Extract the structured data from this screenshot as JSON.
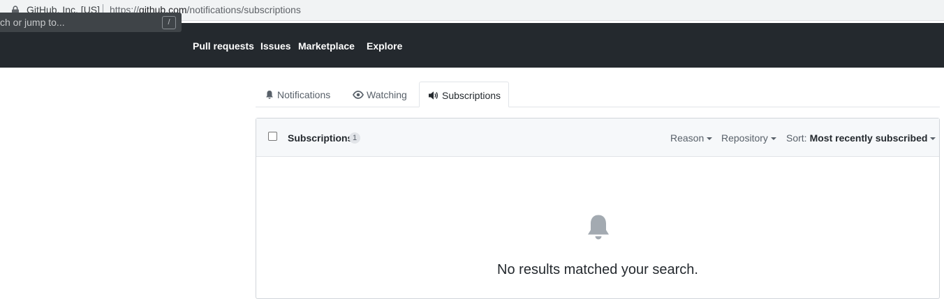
{
  "browser": {
    "site_identity": "GitHub, Inc. [US]",
    "url_scheme": "https://",
    "url_host": "github.com",
    "url_path": "/notifications/subscriptions"
  },
  "header": {
    "search_placeholder": "ch or jump to...",
    "search_shortcut": "/",
    "nav": [
      "Pull requests",
      "Issues",
      "Marketplace",
      "Explore"
    ]
  },
  "tabs": [
    {
      "label": "Notifications",
      "icon": "bell-icon",
      "selected": false
    },
    {
      "label": "Watching",
      "icon": "eye-icon",
      "selected": false
    },
    {
      "label": "Subscriptions",
      "icon": "megaphone-icon",
      "selected": true
    }
  ],
  "box": {
    "title": "Subscriptions",
    "count": "1",
    "filters": {
      "reason": "Reason",
      "repository": "Repository",
      "sort_prefix": "Sort:",
      "sort_value": "Most recently subscribed"
    },
    "blankslate_icon": "bell-icon",
    "blankslate_message": "No results matched your search."
  },
  "colors": {
    "header_bg": "#24292e",
    "header_text": "#ffffff",
    "muted_text": "#586069",
    "border": "#d1d5da"
  }
}
